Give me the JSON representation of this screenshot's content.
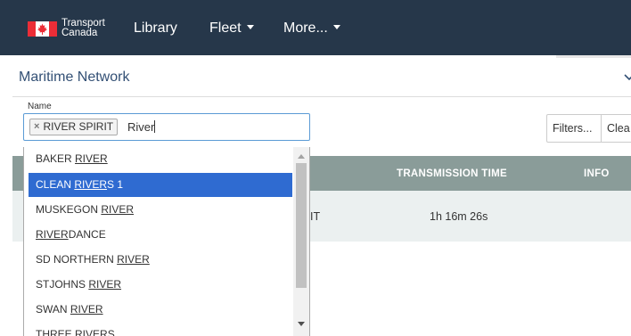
{
  "colors": {
    "nav_bg": "#26374a",
    "title": "#335075",
    "table_header": "#8a9c99",
    "row_bg": "#ebf0f0",
    "highlight": "#2f6bd1",
    "flag_red": "#eb2d37"
  },
  "brand": {
    "line1": "Transport",
    "line2": "Canada",
    "icon": "canada-flag-icon"
  },
  "nav": {
    "library": "Library",
    "fleet": "Fleet",
    "more": "More..."
  },
  "page": {
    "title": "Maritime Network"
  },
  "search": {
    "label": "Name",
    "tag": "RIVER SPIRIT",
    "tag_remove": "×",
    "typed": "River"
  },
  "buttons": {
    "filters": "Filters...",
    "clear": "Clea"
  },
  "table": {
    "headers": {
      "time": "TRANSMISSION TIME",
      "info": "INFO"
    },
    "rows": [
      {
        "name_fragment": "IT",
        "time": "1h 16m 26s"
      }
    ]
  },
  "dropdown": {
    "options": [
      {
        "pre": "BAKER ",
        "match": "RIVER",
        "post": ""
      },
      {
        "pre": "CLEAN ",
        "match": "RIVER",
        "post": "S 1",
        "active": true
      },
      {
        "pre": "MUSKEGON ",
        "match": "RIVER",
        "post": ""
      },
      {
        "pre": "",
        "match": "RIVER",
        "post": "DANCE"
      },
      {
        "pre": "SD NORTHERN ",
        "match": "RIVER",
        "post": ""
      },
      {
        "pre": "STJOHNS ",
        "match": "RIVER",
        "post": ""
      },
      {
        "pre": "SWAN ",
        "match": "RIVER",
        "post": ""
      },
      {
        "pre": "THREE ",
        "match": "RIVER",
        "post": "S"
      }
    ]
  }
}
